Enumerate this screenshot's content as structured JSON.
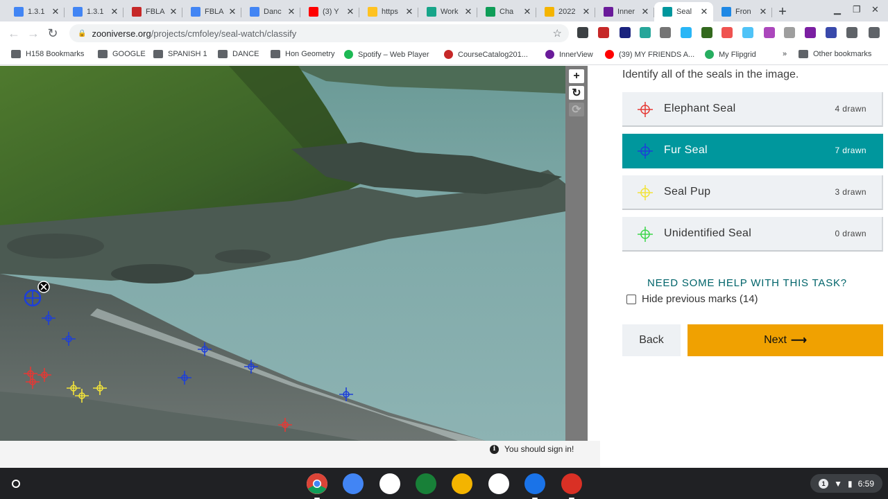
{
  "browser": {
    "tabs": [
      {
        "label": "1.3.1",
        "favicon": "docs-icon",
        "color": "#4285f4"
      },
      {
        "label": "1.3.1",
        "favicon": "docs-icon",
        "color": "#4285f4"
      },
      {
        "label": "FBLA",
        "favicon": "fbla-icon",
        "color": "#c62828"
      },
      {
        "label": "FBLA",
        "favicon": "docs-icon",
        "color": "#4285f4"
      },
      {
        "label": "Danc",
        "favicon": "docs-icon",
        "color": "#4285f4"
      },
      {
        "label": "(3) Y",
        "favicon": "youtube-icon",
        "color": "#ff0000"
      },
      {
        "label": "https",
        "favicon": "walmart-icon",
        "color": "#ffc220"
      },
      {
        "label": "Work",
        "favicon": "shield-icon",
        "color": "#17a589"
      },
      {
        "label": "Cha",
        "favicon": "drive-icon",
        "color": "#0f9d58"
      },
      {
        "label": "2022",
        "favicon": "slides-icon",
        "color": "#f4b400"
      },
      {
        "label": "Inner",
        "favicon": "innerview-icon",
        "color": "#6a1b9a"
      },
      {
        "label": "Seal",
        "favicon": "zooniverse-icon",
        "color": "#00979d",
        "active": true
      },
      {
        "label": "Fron",
        "favicon": "fs-icon",
        "color": "#1e88e5"
      }
    ],
    "new_tab": "+",
    "url_host": "zooniverse.org",
    "url_path": "/projects/cmfoley/seal-watch/classify",
    "extensions": [
      "ext-1",
      "ext-2",
      "ext-3",
      "ext-4",
      "ext-5",
      "ext-6",
      "ext-7",
      "ext-8",
      "ext-9",
      "ext-10",
      "ext-11",
      "ext-12",
      "ext-13",
      "ext-14",
      "ext-15"
    ],
    "bookmarks": [
      {
        "label": "H158 Bookmarks",
        "icon": "folder-icon"
      },
      {
        "label": "GOOGLE",
        "icon": "folder-icon"
      },
      {
        "label": "SPANISH 1",
        "icon": "folder-icon"
      },
      {
        "label": "DANCE",
        "icon": "folder-icon"
      },
      {
        "label": "Hon Geometry",
        "icon": "folder-icon"
      },
      {
        "label": "Spotify – Web Player",
        "icon": "spotify-icon"
      },
      {
        "label": "CourseCatalog201...",
        "icon": "course-icon"
      },
      {
        "label": "InnerView",
        "icon": "innerview-icon"
      },
      {
        "label": "(39) MY FRIENDS A...",
        "icon": "youtube-icon"
      },
      {
        "label": "My Flipgrid",
        "icon": "flipgrid-icon"
      }
    ],
    "overflow": "»",
    "other_bookmarks": "Other bookmarks"
  },
  "task": {
    "instruction": "Identify all of the seals in the image.",
    "tools": [
      {
        "name": "Elephant Seal",
        "count": "4 drawn",
        "color": "#e53935",
        "selected": false
      },
      {
        "name": "Fur Seal",
        "count": "7 drawn",
        "color": "#1e3fd8",
        "selected": true
      },
      {
        "name": "Seal Pup",
        "count": "3 drawn",
        "color": "#f2e33a",
        "selected": false
      },
      {
        "name": "Unidentified Seal",
        "count": "0 drawn",
        "color": "#3cd64a",
        "selected": false
      }
    ],
    "help_text": "NEED SOME HELP WITH THIS TASK?",
    "hide_marks_label": "Hide previous marks (14)",
    "hide_marks_checked": false,
    "back_label": "Back",
    "next_label": "Next",
    "next_arrow": "⟶"
  },
  "subject_viewer": {
    "zoom_in": "+",
    "reset": "↻",
    "rotate": "⟳"
  },
  "signin_notice": "You should sign in!",
  "shelf": {
    "apps": [
      "chrome-icon",
      "docs-icon",
      "play-store-icon",
      "classroom-icon",
      "slides-icon",
      "gmail-icon",
      "files-icon",
      "screen-capture-icon"
    ],
    "notification_count": "1",
    "time": "6:59"
  }
}
